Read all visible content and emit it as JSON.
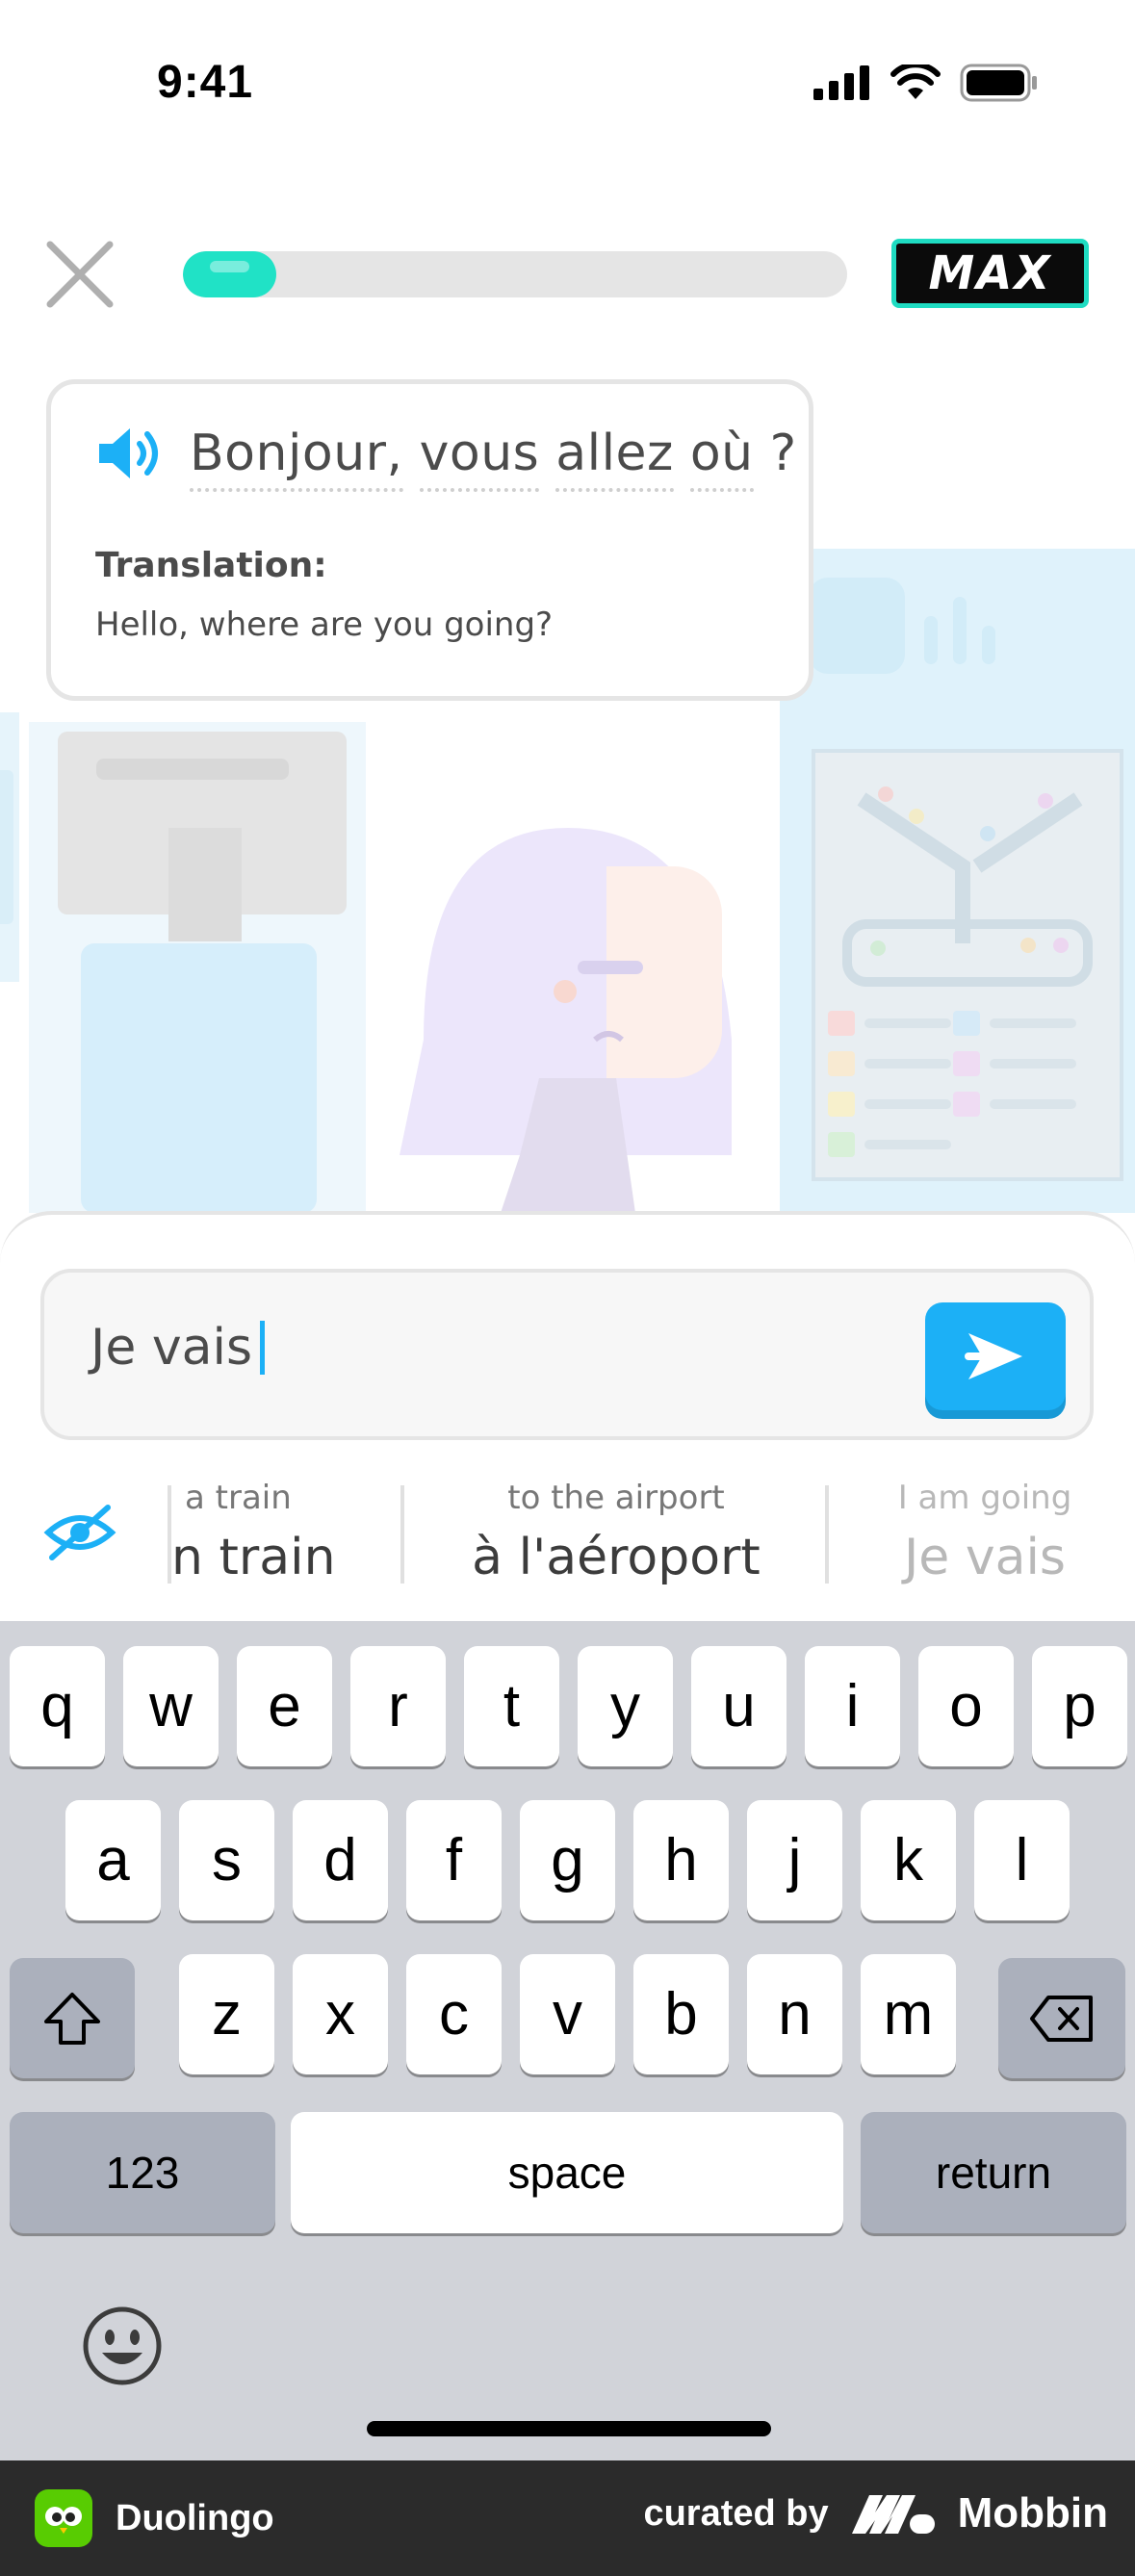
{
  "status_bar": {
    "time": "9:41",
    "signal_icon": "cellular-signal-icon",
    "wifi_icon": "wifi-icon",
    "battery_icon": "battery-icon"
  },
  "lesson_header": {
    "close_icon": "close-icon",
    "progress_fraction": 0.14,
    "badge_label": "MAX"
  },
  "prompt": {
    "speaker_icon": "speaker-icon",
    "words": [
      "Bonjour,",
      "vous",
      "allez",
      "où"
    ],
    "punct": "?",
    "translation_label": "Translation:",
    "translation_text": "Hello, where are you going?"
  },
  "answer": {
    "input_value": "Je vais",
    "send_icon": "send-arrow-icon"
  },
  "suggestions": {
    "hide_icon": "eye-hidden-icon",
    "items": [
      {
        "en": "a train",
        "fr": "n train"
      },
      {
        "en": "to the airport",
        "fr": "à l'aéroport"
      },
      {
        "en": "I am going",
        "fr": "Je vais"
      }
    ]
  },
  "keyboard": {
    "row1": [
      "q",
      "w",
      "e",
      "r",
      "t",
      "y",
      "u",
      "i",
      "o",
      "p"
    ],
    "row2": [
      "a",
      "s",
      "d",
      "f",
      "g",
      "h",
      "j",
      "k",
      "l"
    ],
    "row3": [
      "z",
      "x",
      "c",
      "v",
      "b",
      "n",
      "m"
    ],
    "numbers_label": "123",
    "space_label": "space",
    "return_label": "return",
    "shift_icon": "shift-icon",
    "delete_icon": "delete-icon",
    "emoji_icon": "emoji-icon"
  },
  "footer": {
    "app_name": "Duolingo",
    "curated_label": "curated by",
    "brand": "Mobbin"
  },
  "colors": {
    "accent_blue": "#1cb0f6",
    "progress": "#20e2c6",
    "owl_green": "#58cc02"
  }
}
